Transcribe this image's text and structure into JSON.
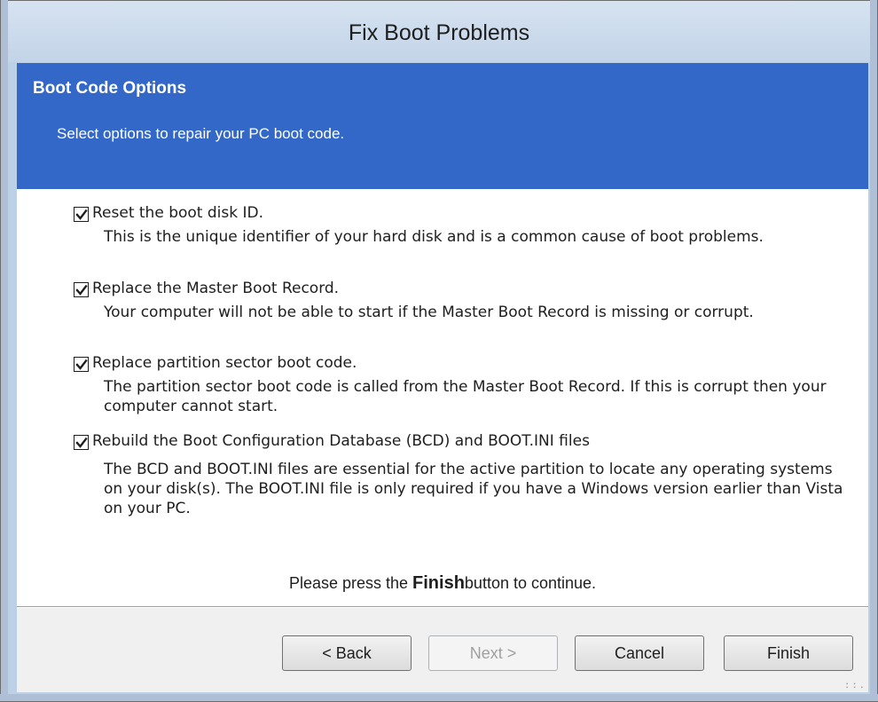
{
  "window": {
    "title": "Fix Boot Problems"
  },
  "banner": {
    "title": "Boot Code Options",
    "subtitle": "Select options to repair your PC boot code."
  },
  "options": [
    {
      "checked": true,
      "label": "Reset the boot disk ID.",
      "description": "This is the unique identifier of your hard disk and is a common cause of boot problems."
    },
    {
      "checked": true,
      "label": "Replace the Master Boot Record.",
      "description": "Your computer will not be able to start if the Master Boot Record is missing or corrupt."
    },
    {
      "checked": true,
      "label": "Replace partition sector boot code.",
      "description": "The partition sector boot code is called from the Master Boot Record. If this is corrupt then your computer cannot start."
    },
    {
      "checked": true,
      "label": "Rebuild the Boot Configuration Database (BCD) and BOOT.INI files",
      "description": "The BCD and BOOT.INI files are essential for the active partition to locate any operating systems on your disk(s). The BOOT.INI file is only required if you have a Windows version earlier than Vista on your PC."
    }
  ],
  "instruction": {
    "prefix": "Please press the",
    "emphasis": "Finish",
    "suffix": "button to continue."
  },
  "buttons": {
    "back": "< Back",
    "next": "Next >",
    "cancel": "Cancel",
    "finish": "Finish"
  },
  "colors": {
    "banner": "#3468c8",
    "frame": "#bcd0e6"
  }
}
